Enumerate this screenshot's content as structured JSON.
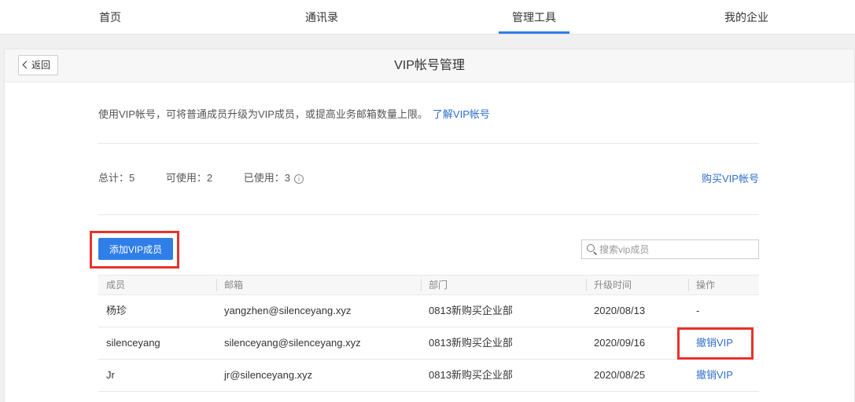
{
  "nav": {
    "tabs": [
      {
        "label": "首页"
      },
      {
        "label": "通讯录"
      },
      {
        "label": "管理工具"
      },
      {
        "label": "我的企业"
      }
    ],
    "active_index": 2
  },
  "header": {
    "back_label": "返回",
    "title": "VIP帐号管理"
  },
  "intro": {
    "text": "使用VIP帐号，可将普通成员升级为VIP成员，或提高业务邮箱数量上限。",
    "link": "了解VIP帐号"
  },
  "stats": {
    "total": "总计：5",
    "available": "可使用：2",
    "used": "已使用：3",
    "info_icon": "info-icon"
  },
  "buy_link": "购买VIP帐号",
  "add_button": "添加VIP成员",
  "search": {
    "placeholder": "搜索vip成员",
    "value": ""
  },
  "table": {
    "columns": [
      "成员",
      "邮箱",
      "部门",
      "升级时间",
      "操作"
    ],
    "rows": [
      {
        "name": "杨珍",
        "email": "yangzhen@silenceyang.xyz",
        "dept": "0813新购买企业部",
        "time": "2020/08/13",
        "action": "-",
        "action_link": false
      },
      {
        "name": "silenceyang",
        "email": "silenceyang@silenceyang.xyz",
        "dept": "0813新购买企业部",
        "time": "2020/09/16",
        "action": "撤销VIP",
        "action_link": true
      },
      {
        "name": "Jr",
        "email": "jr@silenceyang.xyz",
        "dept": "0813新购买企业部",
        "time": "2020/08/25",
        "action": "撤销VIP",
        "action_link": true
      }
    ]
  },
  "colors": {
    "accent": "#2f7ee9",
    "link": "#2f6fc9",
    "highlight": "#e8322c"
  }
}
